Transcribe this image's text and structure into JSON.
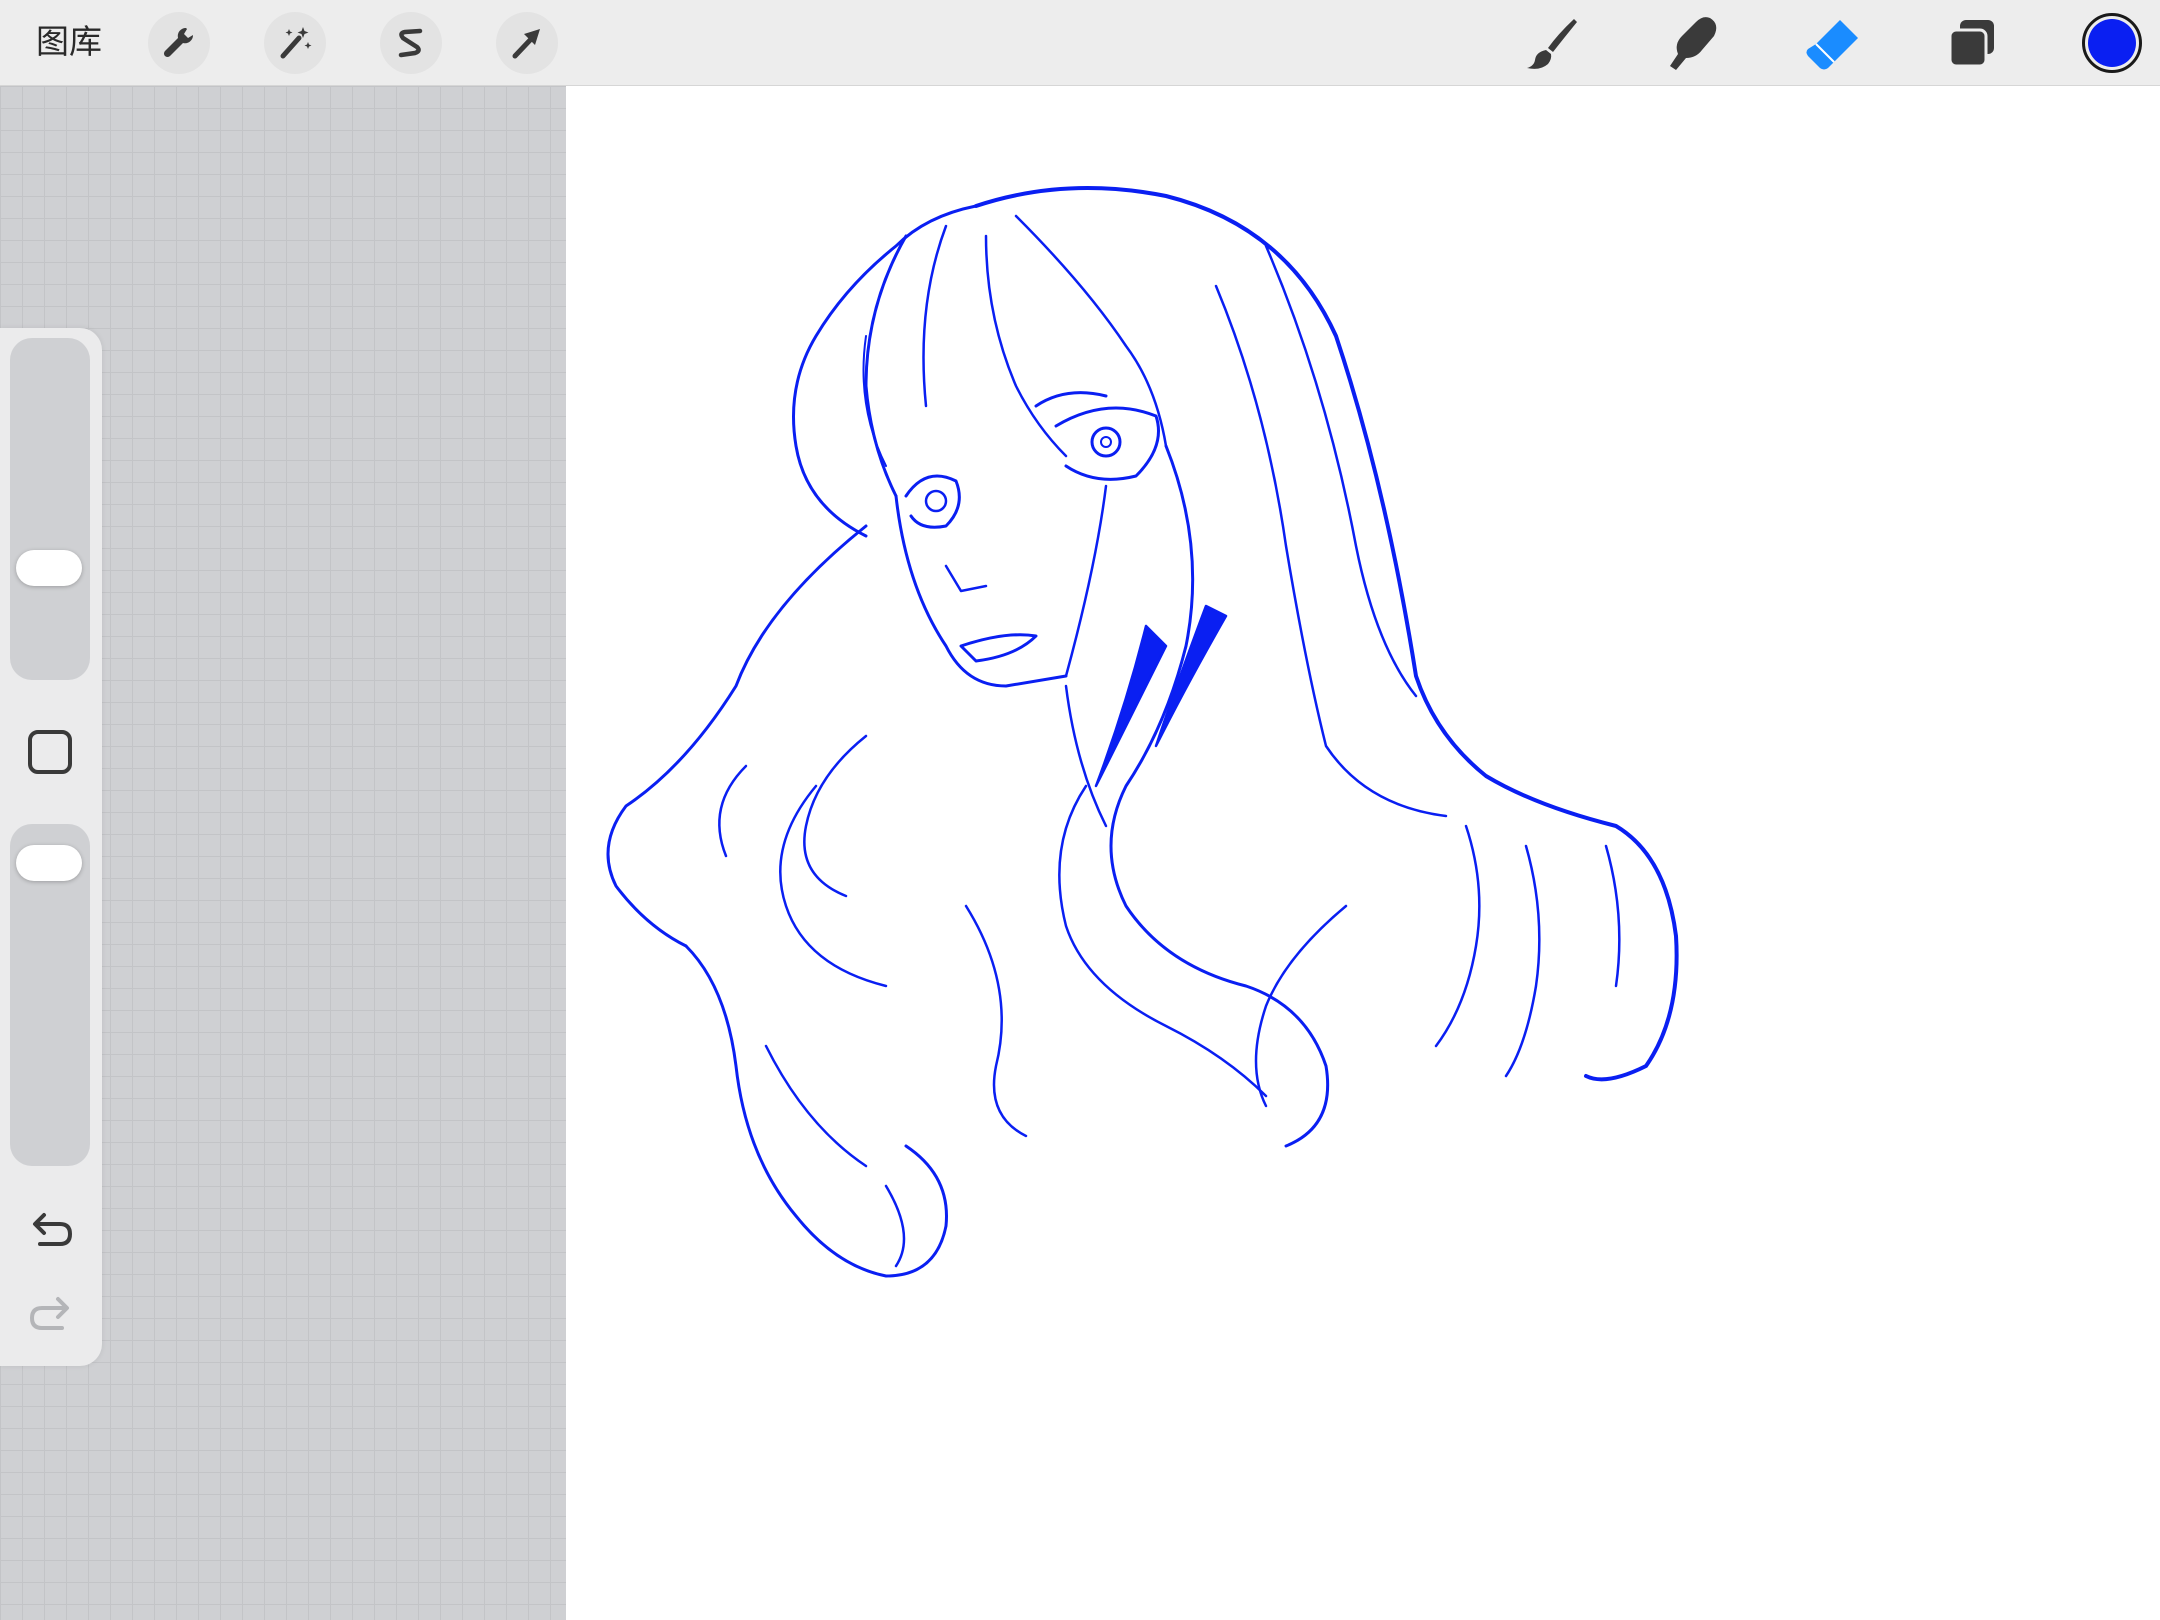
{
  "toolbar": {
    "gallery_label": "图库",
    "left_tools": [
      {
        "name": "actions",
        "icon": "wrench-icon"
      },
      {
        "name": "adjustments",
        "icon": "magic-wand-icon"
      },
      {
        "name": "selection",
        "icon": "selection-s-icon"
      },
      {
        "name": "transform",
        "icon": "arrow-cursor-icon"
      }
    ],
    "right_tools": [
      {
        "name": "brush",
        "icon": "brush-icon",
        "active": false
      },
      {
        "name": "smudge",
        "icon": "smudge-finger-icon",
        "active": false
      },
      {
        "name": "eraser",
        "icon": "eraser-icon",
        "active": true
      },
      {
        "name": "layers",
        "icon": "layers-icon",
        "active": false
      }
    ],
    "current_color": "#0a1ff2"
  },
  "sidebar": {
    "brush_size_level": 0.3,
    "opacity_level": 0.95,
    "modify_icon": "square-modify-icon",
    "undo_icon": "undo-icon",
    "redo_icon": "redo-icon",
    "redo_enabled": false
  },
  "canvas": {
    "background": "#ffffff",
    "stroke_color": "#0a1ff2",
    "subject": "line-art-portrait"
  },
  "colors": {
    "accent_active": "#1a8cff",
    "icon_dark": "#3a3a3a"
  }
}
